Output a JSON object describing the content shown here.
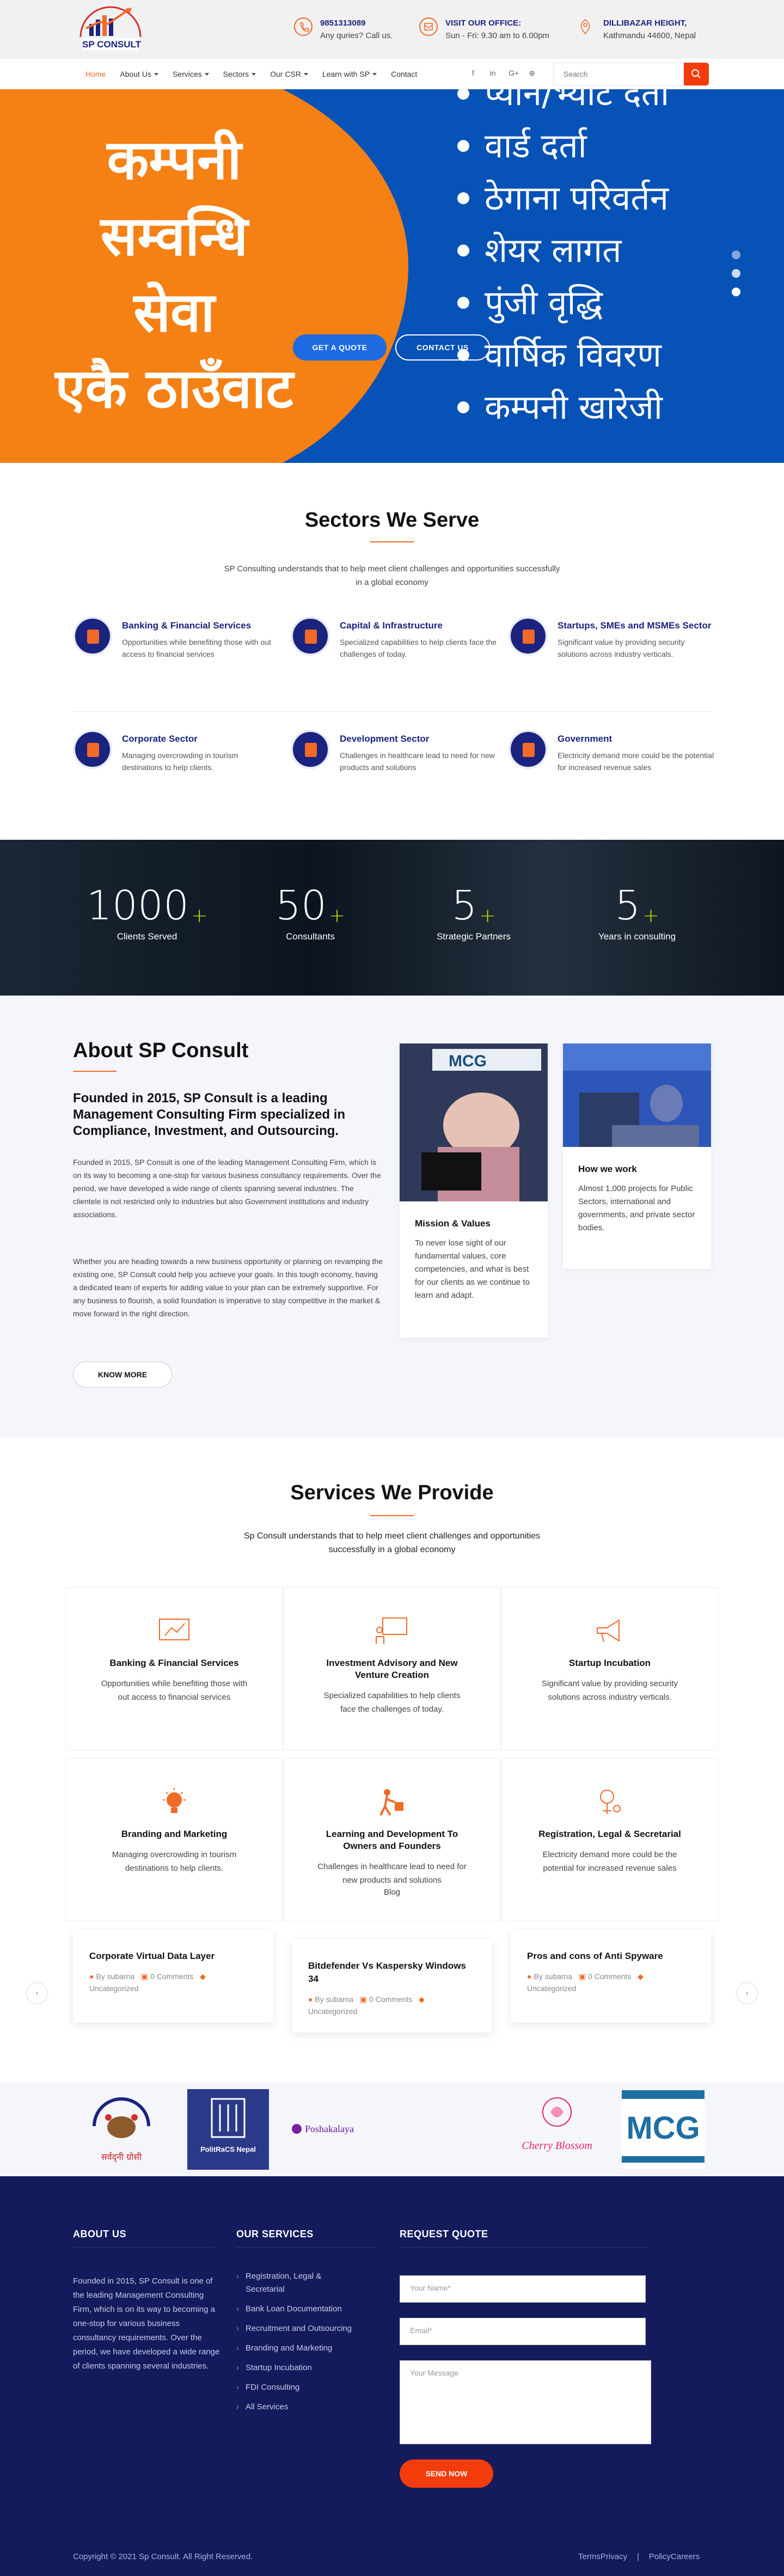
{
  "header": {
    "logo_text": "SP CONSULT",
    "phone": "9851313089",
    "phone_sub": "Any quries? Call us.",
    "office_title": "VISIT OUR OFFICE:",
    "office_hours": "Sun - Fri: 9.30 am to 6.00pm",
    "address_title": "DILLIBAZAR HEIGHT,",
    "address_sub": "Kathmandu 44600, Nepal"
  },
  "nav": {
    "items": [
      {
        "label": "Home"
      },
      {
        "label": "About Us"
      },
      {
        "label": "Services"
      },
      {
        "label": "Sectors"
      },
      {
        "label": "Our CSR"
      },
      {
        "label": "Learn with SP"
      },
      {
        "label": "Contact"
      }
    ],
    "social": [
      "f",
      "in",
      "G+",
      "⊕"
    ],
    "search_placeholder": "Search"
  },
  "hero": {
    "lines": [
      "कम्पनी",
      "सम्वन्धि",
      "सेवा",
      "एकै ठाउँवाट"
    ],
    "list": [
      "प्यान/भ्याट दर्ता",
      "वार्ड दर्ता",
      "ठेगाना परिवर्तन",
      "शेयर लागत",
      "पुंजी वृद्धि",
      "वार्षिक विवरण",
      "कम्पनी खारेजी"
    ],
    "quote_btn": "GET A QUOTE",
    "contact_btn": "CONTACT US"
  },
  "sectors": {
    "title": "Sectors We Serve",
    "subtitle": "SP Consulting understands that to help meet client challenges and opportunities successfully in a global economy",
    "items": [
      {
        "title": "Banking & Financial Services",
        "desc": "Opportunities while benefiting those with out access to financial services"
      },
      {
        "title": "Capital & Infrastructure",
        "desc": "Specialized capabilities to help clients face the challenges of today."
      },
      {
        "title": "Startups, SMEs and MSMEs Sector",
        "desc": "Significant value by providing security solutions across industry verticals."
      },
      {
        "title": "Corporate Sector",
        "desc": "Managing overcrowding in tourism destinations to help clients."
      },
      {
        "title": "Development Sector",
        "desc": "Challenges in healthcare lead to need for new products and solutions"
      },
      {
        "title": "Government",
        "desc": "Electricity demand more could be the potential for increased revenue sales"
      }
    ]
  },
  "stats": [
    {
      "num": "1000",
      "plus": "+",
      "label": "Clients Served"
    },
    {
      "num": "50",
      "plus": "+",
      "label": "Consultants"
    },
    {
      "num": "5",
      "plus": "+",
      "label": "Strategic Partners"
    },
    {
      "num": "5",
      "plus": "+",
      "label": "Years in consulting"
    }
  ],
  "about": {
    "title": "About SP Consult",
    "subtitle": "Founded in 2015, SP Consult is a leading Management Consulting Firm specialized in Compliance, Investment, and Outsourcing.",
    "p1": "Founded in 2015, SP Consult is one of the leading Management Consulting Firm, which is on its way to becoming a one-stop for various business consultancy requirements. Over the period, we have developed a wide range of clients spanning several industries. The clientele is not restricted only to industries but also Government institutions and industry associations.",
    "p2": "Whether you are heading towards a new business opportunity or planning on revamping the existing one, SP Consult could help you achieve your goals. In this tough economy, having a dedicated team of experts for adding value to your plan can be extremely supportive. For any business to flourish, a solid foundation is imperative to stay competitive in the market & move forward in the right direction.",
    "button": "KNOW MORE",
    "card1_title": "Mission & Values",
    "card1_desc": "To never lose sight of our fundamental values, core competencies, and what is best for our clients as we continue to learn and adapt.",
    "card1_img_text": "MCG",
    "card2_title": "How we work",
    "card2_desc": "Almost 1,000 projects for Public Sectors, international and governments, and private sector bodies."
  },
  "services": {
    "title": "Services We Provide",
    "subtitle": "Sp Consult understands that to help meet client challenges and opportunities successfully in a global economy",
    "items": [
      {
        "title": "Banking & Financial Services",
        "desc": "Opportunities while benefiting those with out access to financial services"
      },
      {
        "title": "Investment Advisory and New Venture Creation",
        "desc": "Specialized capabilities to help clients face the challenges of today."
      },
      {
        "title": "Startup Incubation",
        "desc": "Significant value by providing security solutions across industry verticals."
      },
      {
        "title": "Branding and Marketing",
        "desc": "Managing overcrowding in tourism destinations to help clients."
      },
      {
        "title": "Learning and Development To Owners and Founders",
        "desc": "Challenges in healthcare lead to need for new products and solutions"
      },
      {
        "title": "Registration, Legal & Secretarial",
        "desc": "Electricity demand more could be the potential for increased revenue sales"
      }
    ],
    "blog_label": "Blog"
  },
  "posts": [
    {
      "title": "Corporate Virtual Data Layer",
      "author": "",
      "comments": "",
      "category": "Uncategorized"
    },
    {
      "title": "Bitdefender Vs Kaspersky Windows 34",
      "author": "By subarna",
      "comments": "0 Comments",
      "category": "Uncategorized"
    },
    {
      "title": "Pros and cons of Anti Spyware",
      "author": "By subarna",
      "comments": "0 Comments",
      "category": "Uncategorized"
    }
  ],
  "post1_author": "By subarna",
  "post1_comments": "0 Comments",
  "partners": [
    {
      "name": "सर्वद्नी ग्रोसी"
    },
    {
      "name": "PolitRaCS Nepal"
    },
    {
      "name": "Poshakalaya"
    },
    {
      "name": "Cherry Blossom"
    },
    {
      "name": "MCG"
    }
  ],
  "footer": {
    "about_title": "ABOUT US",
    "about_text": "Founded in 2015, SP Consult is one of the leading Management Consulting Firm, which is on its way to becoming a one-stop for various business consultancy requirements. Over the period, we have developed a wide range of clients spanning several industries.",
    "services_title": "OUR SERVICES",
    "services": [
      "Registration, Legal & Secretarial",
      "Bank Loan Documentation",
      "Recruitment and Outsourcing",
      "Branding and Marketing",
      "Startup Incubation",
      "FDI Consulting",
      "All Services"
    ],
    "quote_title": "REQUEST QUOTE",
    "name_ph": "Your Name*",
    "email_ph": "Email*",
    "msg_ph": "Your Message",
    "send": "SEND NOW",
    "copyright": "Copyright © 2021 Sp Consult. All Right Reserved.",
    "terms": "TermsPrivacy",
    "sep": "|",
    "policy": "PolicyCareers"
  },
  "colors": {
    "accent": "#f06a28",
    "navy": "#1a237e",
    "hero_blue": "#0752b6",
    "hero_orange": "#f58014",
    "footer": "#131b5c"
  }
}
